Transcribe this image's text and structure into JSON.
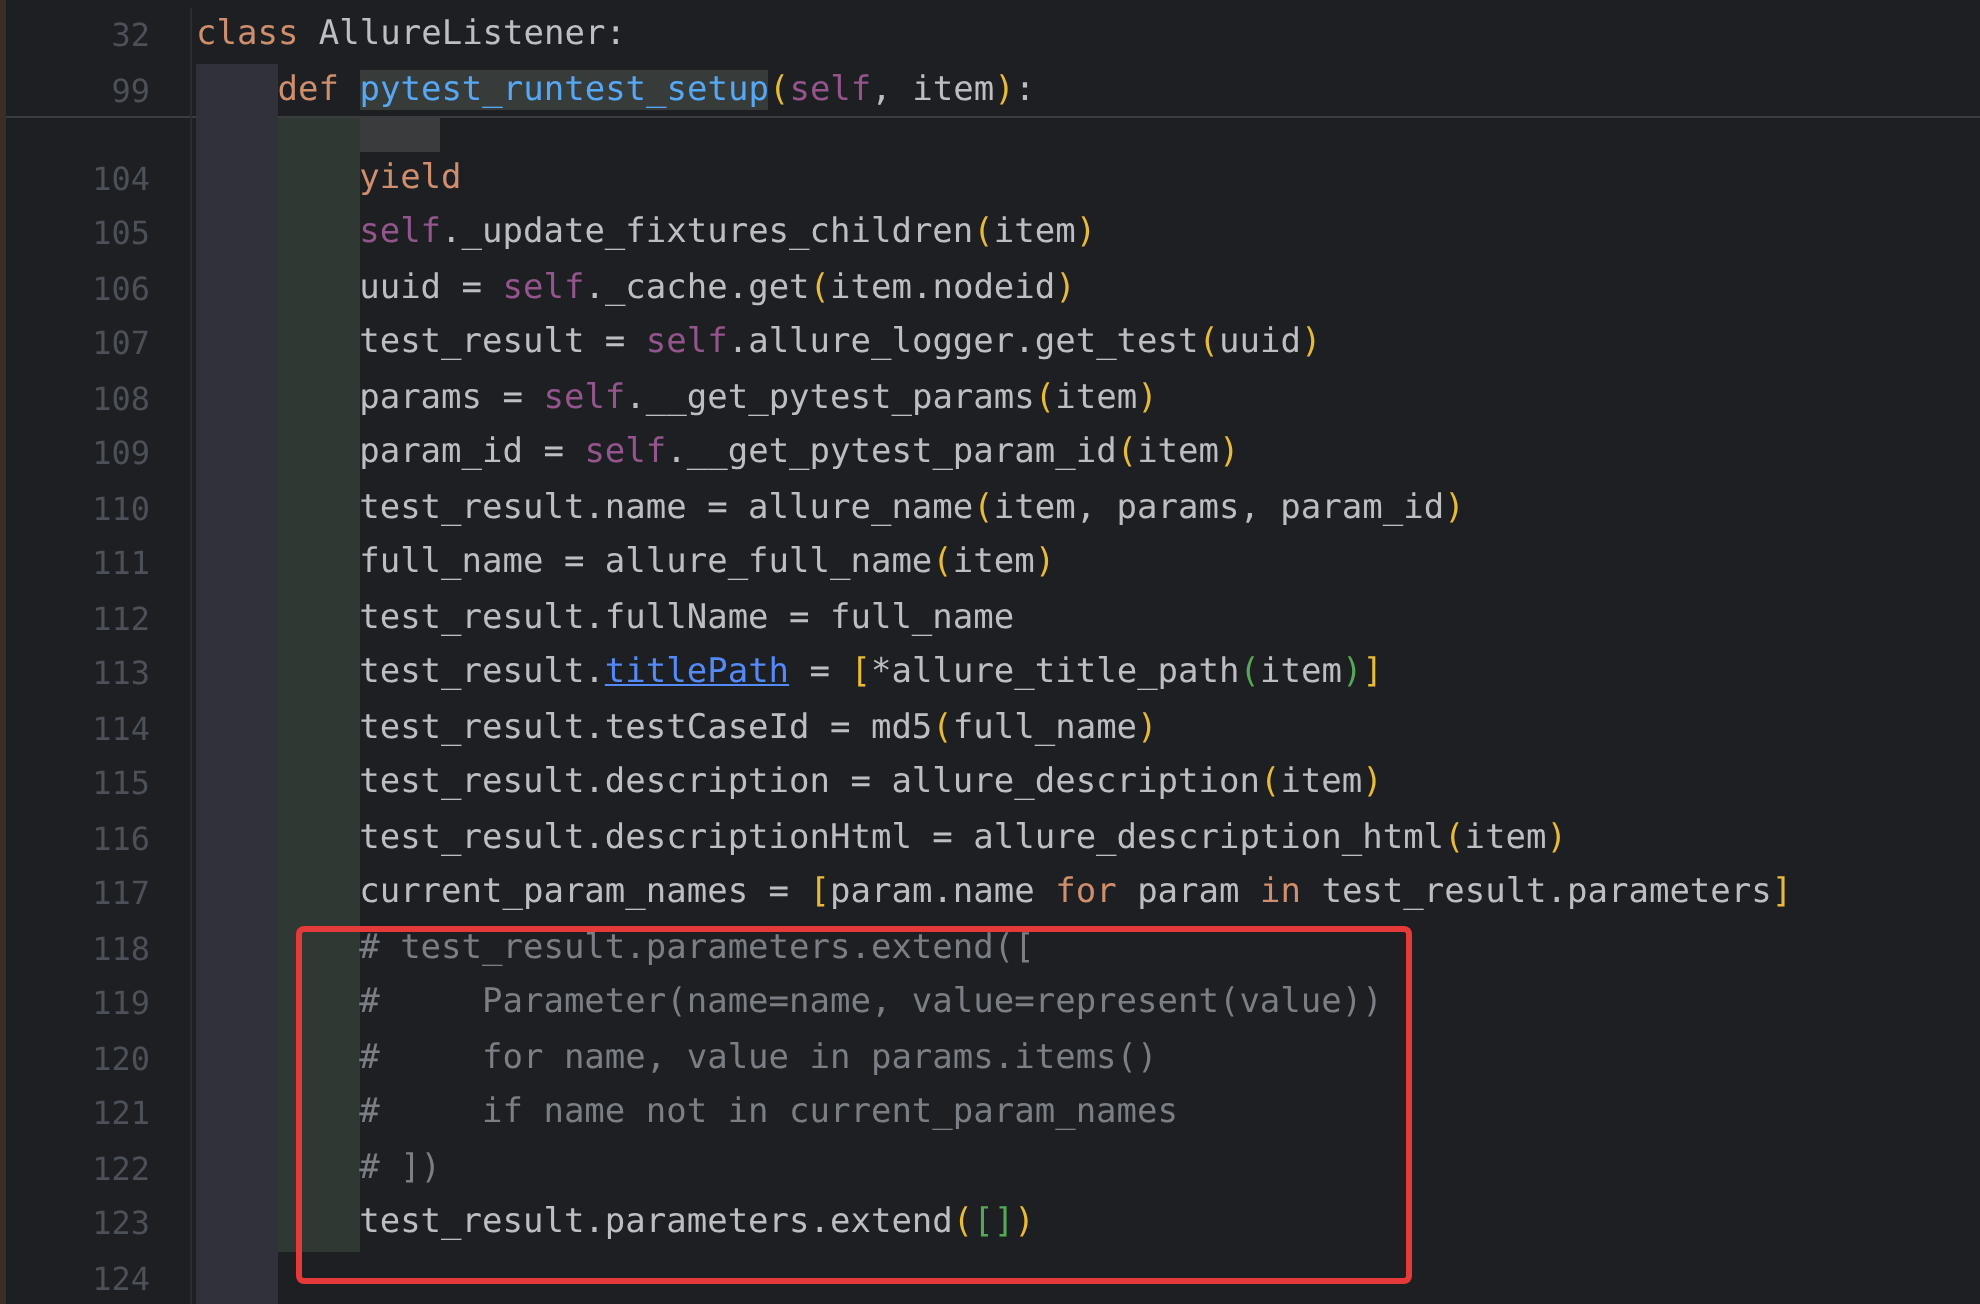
{
  "sticky_lines": [
    {
      "number": "32",
      "tokens": [
        {
          "kind": "keyword",
          "text": "class "
        },
        {
          "kind": "plain",
          "text": "AllureListener:"
        }
      ]
    },
    {
      "number": "99",
      "guides": [
        {
          "kind": "outer"
        }
      ],
      "tokens": [
        {
          "kind": "keyword",
          "text": "def "
        },
        {
          "kind": "function_match",
          "text": "pytest_runtest_setup"
        },
        {
          "kind": "bracket",
          "text": "("
        },
        {
          "kind": "self",
          "text": "self"
        },
        {
          "kind": "plain",
          "text": ", item"
        },
        {
          "kind": "bracket",
          "text": ")"
        },
        {
          "kind": "plain",
          "text": ":"
        }
      ]
    }
  ],
  "lines": [
    {
      "guides": [
        {
          "kind": "outer"
        },
        {
          "kind": "scope"
        },
        {
          "kind": "inner"
        }
      ]
    },
    {
      "number": "104",
      "guides": [
        {
          "kind": "outer"
        },
        {
          "kind": "scope"
        }
      ],
      "tokens": [
        {
          "kind": "keyword",
          "text": "yield"
        }
      ]
    },
    {
      "number": "105",
      "guides": [
        {
          "kind": "outer"
        },
        {
          "kind": "scope"
        }
      ],
      "tokens": [
        {
          "kind": "self",
          "text": "self"
        },
        {
          "kind": "plain",
          "text": "._update_fixtures_children"
        },
        {
          "kind": "bracket",
          "text": "("
        },
        {
          "kind": "plain",
          "text": "item"
        },
        {
          "kind": "bracket",
          "text": ")"
        }
      ]
    },
    {
      "number": "106",
      "guides": [
        {
          "kind": "outer"
        },
        {
          "kind": "scope"
        }
      ],
      "tokens": [
        {
          "kind": "plain",
          "text": "uuid = "
        },
        {
          "kind": "self",
          "text": "self"
        },
        {
          "kind": "plain",
          "text": "._cache.get"
        },
        {
          "kind": "bracket",
          "text": "("
        },
        {
          "kind": "plain",
          "text": "item.nodeid"
        },
        {
          "kind": "bracket",
          "text": ")"
        }
      ]
    },
    {
      "number": "107",
      "guides": [
        {
          "kind": "outer"
        },
        {
          "kind": "scope"
        }
      ],
      "tokens": [
        {
          "kind": "plain",
          "text": "test_result = "
        },
        {
          "kind": "self",
          "text": "self"
        },
        {
          "kind": "plain",
          "text": ".allure_logger.get_test"
        },
        {
          "kind": "bracket",
          "text": "("
        },
        {
          "kind": "plain",
          "text": "uuid"
        },
        {
          "kind": "bracket",
          "text": ")"
        }
      ]
    },
    {
      "number": "108",
      "guides": [
        {
          "kind": "outer"
        },
        {
          "kind": "scope"
        }
      ],
      "tokens": [
        {
          "kind": "plain",
          "text": "params = "
        },
        {
          "kind": "self",
          "text": "self"
        },
        {
          "kind": "plain",
          "text": ".__get_pytest_params"
        },
        {
          "kind": "bracket",
          "text": "("
        },
        {
          "kind": "plain",
          "text": "item"
        },
        {
          "kind": "bracket",
          "text": ")"
        }
      ]
    },
    {
      "number": "109",
      "guides": [
        {
          "kind": "outer"
        },
        {
          "kind": "scope"
        }
      ],
      "tokens": [
        {
          "kind": "plain",
          "text": "param_id = "
        },
        {
          "kind": "self",
          "text": "self"
        },
        {
          "kind": "plain",
          "text": ".__get_pytest_param_id"
        },
        {
          "kind": "bracket",
          "text": "("
        },
        {
          "kind": "plain",
          "text": "item"
        },
        {
          "kind": "bracket",
          "text": ")"
        }
      ]
    },
    {
      "number": "110",
      "guides": [
        {
          "kind": "outer"
        },
        {
          "kind": "scope"
        }
      ],
      "tokens": [
        {
          "kind": "plain",
          "text": "test_result.name = allure_name"
        },
        {
          "kind": "bracket",
          "text": "("
        },
        {
          "kind": "plain",
          "text": "item, params, param_id"
        },
        {
          "kind": "bracket",
          "text": ")"
        }
      ]
    },
    {
      "number": "111",
      "guides": [
        {
          "kind": "outer"
        },
        {
          "kind": "scope"
        }
      ],
      "tokens": [
        {
          "kind": "plain",
          "text": "full_name = allure_full_name"
        },
        {
          "kind": "bracket",
          "text": "("
        },
        {
          "kind": "plain",
          "text": "item"
        },
        {
          "kind": "bracket",
          "text": ")"
        }
      ]
    },
    {
      "number": "112",
      "guides": [
        {
          "kind": "outer"
        },
        {
          "kind": "scope"
        }
      ],
      "tokens": [
        {
          "kind": "plain",
          "text": "test_result.fullName = full_name"
        }
      ]
    },
    {
      "number": "113",
      "guides": [
        {
          "kind": "outer"
        },
        {
          "kind": "scope"
        }
      ],
      "tokens": [
        {
          "kind": "plain",
          "text": "test_result."
        },
        {
          "kind": "link",
          "text": "titlePath"
        },
        {
          "kind": "plain",
          "text": " = "
        },
        {
          "kind": "bracket",
          "text": "["
        },
        {
          "kind": "plain",
          "text": "*allure_title_path"
        },
        {
          "kind": "bracket2",
          "text": "("
        },
        {
          "kind": "plain",
          "text": "item"
        },
        {
          "kind": "bracket2",
          "text": ")"
        },
        {
          "kind": "bracket",
          "text": "]"
        }
      ]
    },
    {
      "number": "114",
      "guides": [
        {
          "kind": "outer"
        },
        {
          "kind": "scope"
        }
      ],
      "tokens": [
        {
          "kind": "plain",
          "text": "test_result.testCaseId = md5"
        },
        {
          "kind": "bracket",
          "text": "("
        },
        {
          "kind": "plain",
          "text": "full_name"
        },
        {
          "kind": "bracket",
          "text": ")"
        }
      ]
    },
    {
      "number": "115",
      "guides": [
        {
          "kind": "outer"
        },
        {
          "kind": "scope"
        }
      ],
      "tokens": [
        {
          "kind": "plain",
          "text": "test_result.description = allure_description"
        },
        {
          "kind": "bracket",
          "text": "("
        },
        {
          "kind": "plain",
          "text": "item"
        },
        {
          "kind": "bracket",
          "text": ")"
        }
      ]
    },
    {
      "number": "116",
      "guides": [
        {
          "kind": "outer"
        },
        {
          "kind": "scope"
        }
      ],
      "tokens": [
        {
          "kind": "plain",
          "text": "test_result.descriptionHtml = allure_description_html"
        },
        {
          "kind": "bracket",
          "text": "("
        },
        {
          "kind": "plain",
          "text": "item"
        },
        {
          "kind": "bracket",
          "text": ")"
        }
      ]
    },
    {
      "number": "117",
      "guides": [
        {
          "kind": "outer"
        },
        {
          "kind": "scope"
        }
      ],
      "tokens": [
        {
          "kind": "plain",
          "text": "current_param_names = "
        },
        {
          "kind": "bracket",
          "text": "["
        },
        {
          "kind": "plain",
          "text": "param.name "
        },
        {
          "kind": "keyword",
          "text": "for"
        },
        {
          "kind": "plain",
          "text": " param "
        },
        {
          "kind": "keyword",
          "text": "in"
        },
        {
          "kind": "plain",
          "text": " test_result.parameters"
        },
        {
          "kind": "bracket",
          "text": "]"
        }
      ]
    },
    {
      "number": "118",
      "guides": [
        {
          "kind": "outer"
        },
        {
          "kind": "scope"
        }
      ],
      "boxed": true,
      "tokens": [
        {
          "kind": "comment",
          "text": "# test_result.parameters.extend(["
        }
      ]
    },
    {
      "number": "119",
      "guides": [
        {
          "kind": "outer"
        },
        {
          "kind": "scope"
        }
      ],
      "boxed": true,
      "tokens": [
        {
          "kind": "comment",
          "text": "#     Parameter(name=name, value=represent(value))"
        }
      ]
    },
    {
      "number": "120",
      "guides": [
        {
          "kind": "outer"
        },
        {
          "kind": "scope"
        }
      ],
      "boxed": true,
      "tokens": [
        {
          "kind": "comment",
          "text": "#     for name, value in params.items()"
        }
      ]
    },
    {
      "number": "121",
      "guides": [
        {
          "kind": "outer"
        },
        {
          "kind": "scope"
        }
      ],
      "boxed": true,
      "tokens": [
        {
          "kind": "comment",
          "text": "#     if name not in current_param_names"
        }
      ]
    },
    {
      "number": "122",
      "guides": [
        {
          "kind": "outer"
        },
        {
          "kind": "scope"
        }
      ],
      "boxed": true,
      "tokens": [
        {
          "kind": "comment",
          "text": "# ])"
        }
      ]
    },
    {
      "number": "123",
      "guides": [
        {
          "kind": "outer"
        },
        {
          "kind": "scope"
        }
      ],
      "boxed": true,
      "tokens": [
        {
          "kind": "plain",
          "text": "test_result.parameters.extend"
        },
        {
          "kind": "bracket",
          "text": "("
        },
        {
          "kind": "bracket2",
          "text": "[]"
        },
        {
          "kind": "bracket",
          "text": ")"
        }
      ]
    },
    {
      "number": "124",
      "guides": [
        {
          "kind": "outer"
        }
      ]
    }
  ]
}
